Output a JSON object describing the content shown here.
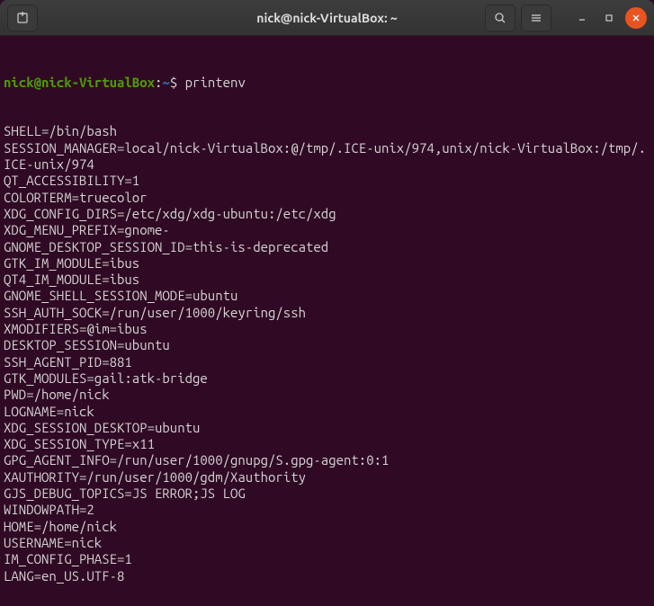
{
  "titlebar": {
    "title": "nick@nick-VirtualBox: ~"
  },
  "prompt": {
    "user_host": "nick@nick-VirtualBox",
    "colon": ":",
    "path": "~",
    "dollar": "$ ",
    "command": "printenv"
  },
  "output": [
    "SHELL=/bin/bash",
    "SESSION_MANAGER=local/nick-VirtualBox:@/tmp/.ICE-unix/974,unix/nick-VirtualBox:/tmp/.ICE-unix/974",
    "QT_ACCESSIBILITY=1",
    "COLORTERM=truecolor",
    "XDG_CONFIG_DIRS=/etc/xdg/xdg-ubuntu:/etc/xdg",
    "XDG_MENU_PREFIX=gnome-",
    "GNOME_DESKTOP_SESSION_ID=this-is-deprecated",
    "GTK_IM_MODULE=ibus",
    "QT4_IM_MODULE=ibus",
    "GNOME_SHELL_SESSION_MODE=ubuntu",
    "SSH_AUTH_SOCK=/run/user/1000/keyring/ssh",
    "XMODIFIERS=@im=ibus",
    "DESKTOP_SESSION=ubuntu",
    "SSH_AGENT_PID=881",
    "GTK_MODULES=gail:atk-bridge",
    "PWD=/home/nick",
    "LOGNAME=nick",
    "XDG_SESSION_DESKTOP=ubuntu",
    "XDG_SESSION_TYPE=x11",
    "GPG_AGENT_INFO=/run/user/1000/gnupg/S.gpg-agent:0:1",
    "XAUTHORITY=/run/user/1000/gdm/Xauthority",
    "GJS_DEBUG_TOPICS=JS ERROR;JS LOG",
    "WINDOWPATH=2",
    "HOME=/home/nick",
    "USERNAME=nick",
    "IM_CONFIG_PHASE=1",
    "LANG=en_US.UTF-8"
  ]
}
